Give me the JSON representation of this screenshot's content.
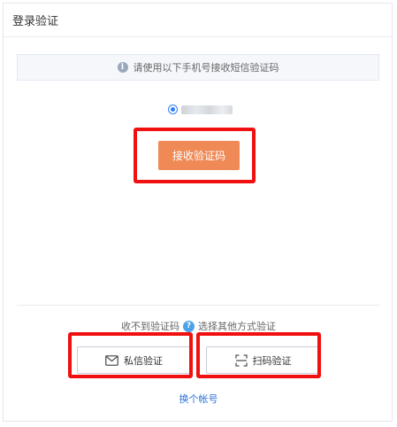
{
  "header": {
    "title": "登录验证"
  },
  "notice": {
    "text": "请使用以下手机号接收短信验证码",
    "icon": "info-icon"
  },
  "phone": {
    "selected": true,
    "masked": true
  },
  "receive_button": {
    "label": "接收验证码",
    "color": "#ef8a57"
  },
  "alternatives": {
    "prompt_left": "收不到验证码",
    "prompt_right": "选择其他方式验证",
    "private_message_label": "私信验证",
    "scan_label": "扫码验证"
  },
  "switch_account": {
    "label": "换个帐号",
    "color": "#2d74d9"
  },
  "highlight_color": "#f01010"
}
